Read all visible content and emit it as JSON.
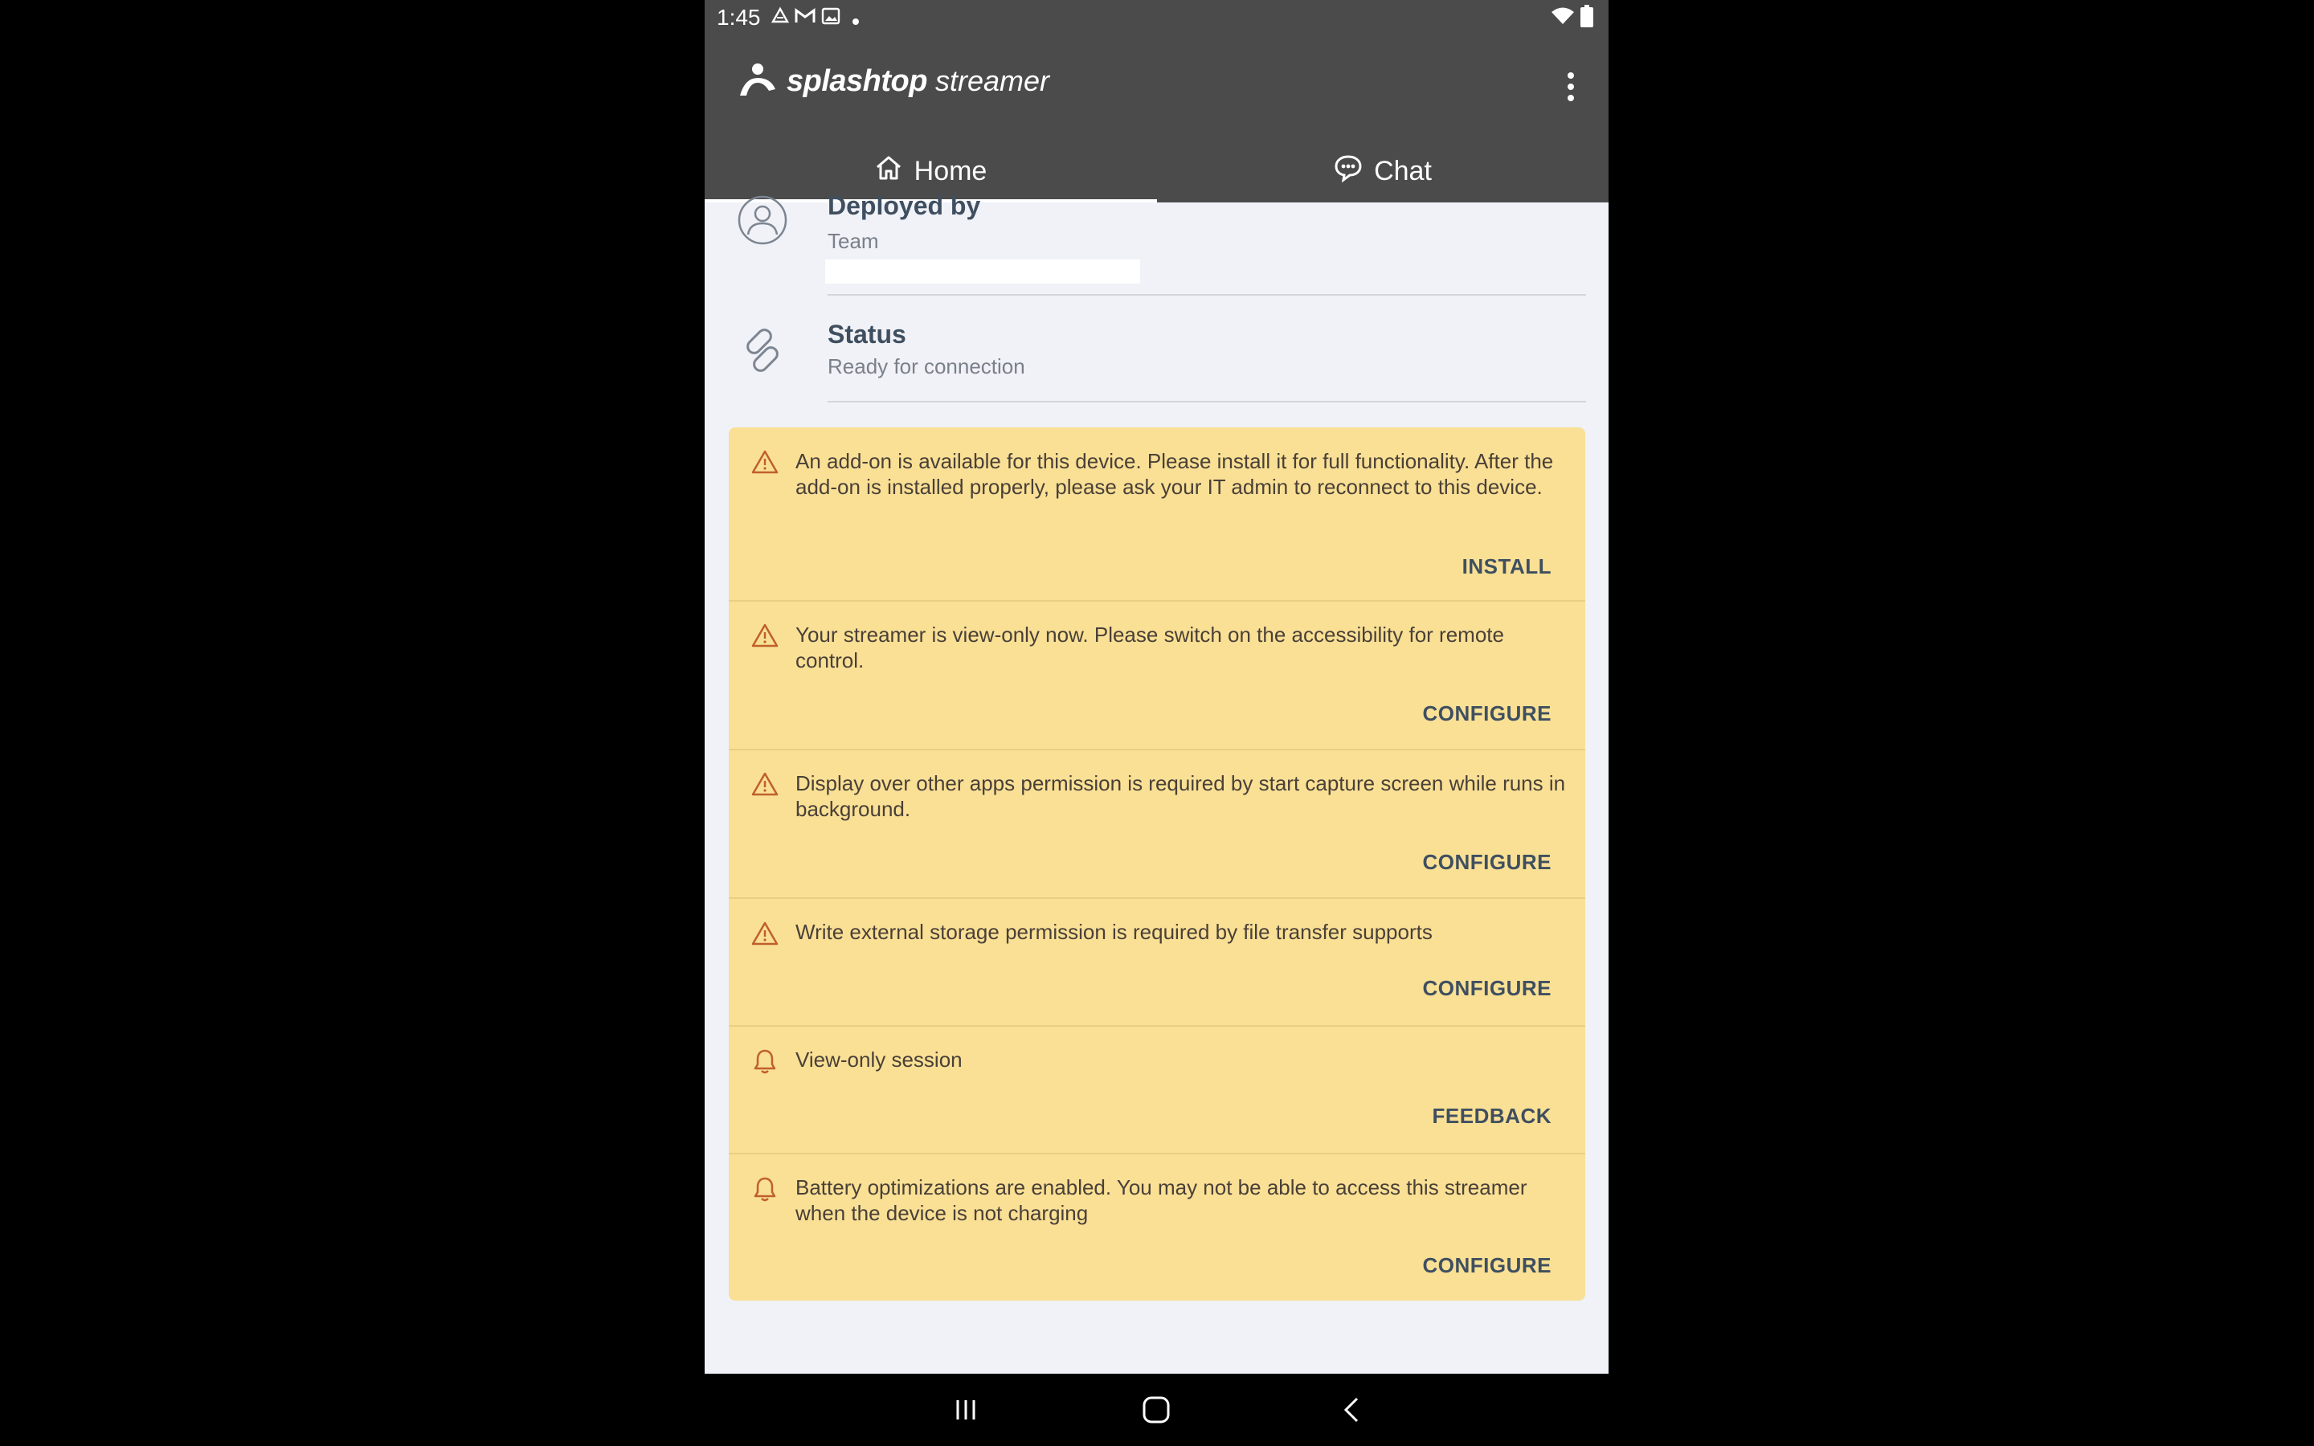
{
  "status_bar": {
    "time": "1:45",
    "icons_left": [
      "drive-icon",
      "gmail-icon",
      "image-icon",
      "dot-icon"
    ],
    "icons_right": [
      "wifi-icon",
      "battery-icon"
    ]
  },
  "app_bar": {
    "brand": "splashtop",
    "product": "streamer",
    "menu_icon": "more-vert-icon"
  },
  "tabs": [
    {
      "label": "Home",
      "icon": "home-icon",
      "selected": true
    },
    {
      "label": "Chat",
      "icon": "chat-icon",
      "selected": false
    }
  ],
  "info": {
    "deployed_by": {
      "title": "Deployed by",
      "value": "Team"
    },
    "status": {
      "title": "Status",
      "value": "Ready for connection"
    }
  },
  "alerts": [
    {
      "icon": "warning-icon",
      "text": "An add-on is available for this device. Please install it for full functionality. After the add-on is installed properly, please ask your IT admin to reconnect to this device.",
      "action": "INSTALL"
    },
    {
      "icon": "warning-icon",
      "text": "Your streamer is view-only now. Please switch on the accessibility for remote control.",
      "action": "CONFIGURE"
    },
    {
      "icon": "warning-icon",
      "text": "Display over other apps permission is required by start capture screen while runs in background.",
      "action": "CONFIGURE"
    },
    {
      "icon": "warning-icon",
      "text": "Write external storage permission is required by file transfer supports",
      "action": "CONFIGURE"
    },
    {
      "icon": "bell-icon",
      "text": "View-only session",
      "action": "FEEDBACK"
    },
    {
      "icon": "bell-icon",
      "text": "Battery optimizations are enabled. You may not be able to access this streamer when the device is not charging",
      "action": "CONFIGURE"
    }
  ],
  "colors": {
    "app_bar": "#4b4b4b",
    "alert_background": "#f9e095",
    "alert_icon": "#c0602a",
    "action_text": "#3f4f60",
    "content_background": "#f0f2f7"
  },
  "nav_bar": {
    "buttons": [
      "recent-apps-icon",
      "home-nav-icon",
      "back-icon"
    ]
  }
}
